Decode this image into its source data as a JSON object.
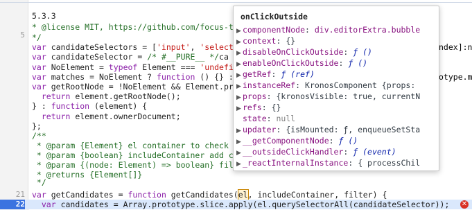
{
  "editor": {
    "lines": [
      {
        "n": "",
        "segs": [
          [
            "5.3.3",
            ""
          ]
        ]
      },
      {
        "n": "",
        "segs": [
          [
            "* @license MIT, https://github.com/focus-t",
            "cm"
          ]
        ]
      },
      {
        "n": "",
        "segs": [
          [
            "*/",
            "cm"
          ]
        ]
      },
      {
        "n": "",
        "segs": [
          [
            "var",
            "kw"
          ],
          [
            " candidateSelectors = [",
            ""
          ],
          [
            "'input'",
            "str"
          ],
          [
            ", ",
            ""
          ],
          [
            "'select",
            "str"
          ]
        ]
      },
      {
        "n": "",
        "segs": [
          [
            "var",
            "kw"
          ],
          [
            " candidateSelector = ",
            ""
          ],
          [
            "/* #__PURE__ */",
            "cm"
          ],
          [
            "ca",
            ""
          ]
        ]
      },
      {
        "n": "",
        "segs": [
          [
            "var",
            "kw"
          ],
          [
            " NoElement = ",
            ""
          ],
          [
            "typeof",
            "kw"
          ],
          [
            " Element === ",
            ""
          ],
          [
            "'undefi",
            "str"
          ]
        ]
      },
      {
        "n": "",
        "segs": [
          [
            "var",
            "kw"
          ],
          [
            " matches = NoElement ? ",
            ""
          ],
          [
            "function",
            "kw"
          ],
          [
            " () {} :",
            ""
          ]
        ]
      },
      {
        "n": "",
        "segs": [
          [
            "var",
            "kw"
          ],
          [
            " getRootNode = !NoElement && Element.pr",
            ""
          ]
        ]
      },
      {
        "n": "",
        "segs": [
          [
            "  ",
            ""
          ],
          [
            "return",
            "kw"
          ],
          [
            " element.getRootNode();",
            ""
          ]
        ]
      },
      {
        "n": "",
        "segs": [
          [
            "} : ",
            ""
          ],
          [
            "function",
            "kw"
          ],
          [
            " (element) {",
            ""
          ]
        ]
      },
      {
        "n": "",
        "segs": [
          [
            "  ",
            ""
          ],
          [
            "return",
            "kw"
          ],
          [
            " element.ownerDocument;",
            ""
          ]
        ]
      },
      {
        "n": "",
        "segs": [
          [
            "};",
            ""
          ]
        ]
      },
      {
        "n": "",
        "segs": [
          [
            "/**",
            "cm"
          ]
        ]
      },
      {
        "n": "",
        "segs": [
          [
            " * @param {Element} el container to check",
            "cm"
          ]
        ]
      },
      {
        "n": "",
        "segs": [
          [
            " * @param {boolean} includeContainer add c",
            "cm"
          ]
        ]
      },
      {
        "n": "",
        "segs": [
          [
            " * @param {(node: Element) => boolean} fil",
            "cm"
          ]
        ]
      },
      {
        "n": "",
        "segs": [
          [
            " * @returns {Element[]}",
            "cm"
          ]
        ]
      },
      {
        "n": "",
        "segs": [
          [
            " */",
            "cm"
          ]
        ]
      },
      {
        "n": "",
        "segs": []
      },
      {
        "n": "21",
        "segs": [
          [
            "var",
            "kw"
          ],
          [
            " getCandidates = ",
            ""
          ],
          [
            "function",
            "kw"
          ],
          [
            " getCandidates(",
            ""
          ],
          [
            "el",
            "hl"
          ],
          [
            ", includeContainer, filter) {",
            ""
          ]
        ]
      },
      {
        "n": "22",
        "exec": true,
        "segs": [
          [
            "  ",
            ""
          ],
          [
            "var",
            "kw"
          ],
          [
            " candidates = Array.prototype.slice.apply(el.querySelectorAll(candidateSelector));",
            ""
          ]
        ]
      }
    ],
    "right_fragments": [
      "ndex]:n",
      "otype.m"
    ],
    "gutter_numbers": [
      "5"
    ]
  },
  "popover": {
    "title": "onClickOutside",
    "properties": [
      {
        "name": "componentNode",
        "value": "div.editorExtra.bubble",
        "kind": "tag",
        "expandable": true
      },
      {
        "name": "context",
        "value": "{}",
        "kind": "obj",
        "expandable": true
      },
      {
        "name": "disableOnClickOutside",
        "value": "ƒ ()",
        "kind": "fn",
        "expandable": true
      },
      {
        "name": "enableOnClickOutside",
        "value": "ƒ ()",
        "kind": "fn",
        "expandable": true
      },
      {
        "name": "getRef",
        "value": "ƒ (ref)",
        "kind": "fn",
        "expandable": true
      },
      {
        "name": "instanceRef",
        "value": "KronosComponent {props:",
        "kind": "obj",
        "expandable": true
      },
      {
        "name": "props",
        "value": "{kronosVisible: true, currentN",
        "kind": "obj",
        "expandable": true
      },
      {
        "name": "refs",
        "value": "{}",
        "kind": "obj",
        "expandable": true
      },
      {
        "name": "state",
        "value": "null",
        "kind": "null",
        "expandable": false
      },
      {
        "name": "updater",
        "value": "{isMounted: ƒ, enqueueSetSta",
        "kind": "obj",
        "expandable": true
      },
      {
        "name": "__getComponentNode",
        "value": "ƒ ()",
        "kind": "fn",
        "expandable": true
      },
      {
        "name": "__outsideClickHandler",
        "value": "ƒ (event)",
        "kind": "fn",
        "expandable": true
      },
      {
        "name": "_reactInternalInstance",
        "value": "{ processChil",
        "kind": "obj",
        "expandable": true
      }
    ]
  },
  "colors": {
    "exec_line_bg": "#dae8fc",
    "exec_line_number_bg": "#3b73e0",
    "error_marker": "#d93025"
  },
  "icons": {
    "error": "error-circle-icon",
    "expand": "expand-triangle-icon"
  }
}
